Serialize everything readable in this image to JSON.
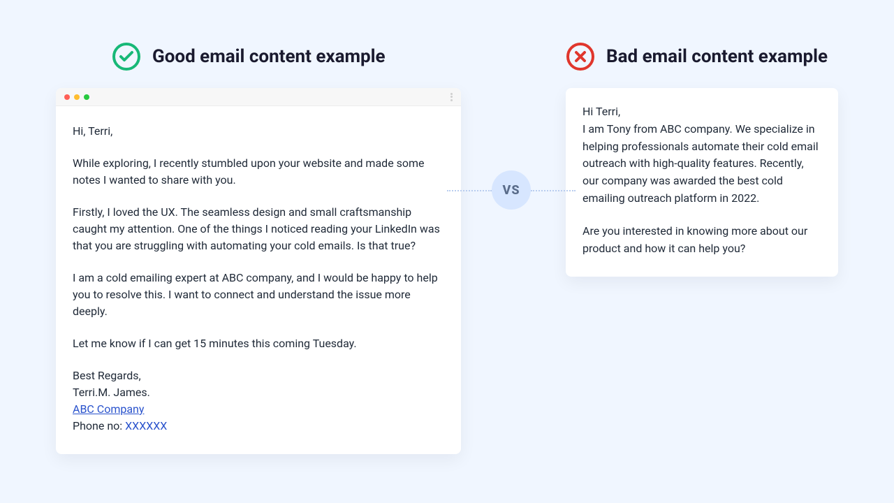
{
  "good": {
    "title": "Good email content example",
    "icon": "check-circle-icon",
    "greeting": "Hi, Terri,",
    "para1": "While exploring, I recently stumbled upon your website and made some notes I wanted to share with you.",
    "para2": "Firstly, I loved the UX. The seamless design and small craftsmanship caught my attention. One of the things I noticed reading your LinkedIn was that you are struggling with automating your cold emails. Is that true?",
    "para3": "I am a cold emailing expert at ABC company, and I would be happy to help you to resolve this. I want to connect and understand the issue more deeply.",
    "para4": "Let me know if I can get 15 minutes this coming Tuesday.",
    "signoff": "Best Regards,",
    "signature_name": "Terri.M. James.",
    "company_link": "ABC Company",
    "phone_label": "Phone no: ",
    "phone_value": "XXXXXX"
  },
  "bad": {
    "title": "Bad email content example",
    "icon": "x-circle-icon",
    "greeting": "Hi Terri,",
    "para1": "I am Tony from ABC company. We specialize in helping professionals automate their cold email outreach with high-quality features. Recently, our company was awarded the best cold emailing outreach platform in 2022.",
    "para2": "Are you interested in knowing more about our product and how it can help you?"
  },
  "vs_label": "VS",
  "colors": {
    "good": "#17b877",
    "bad": "#e0362c",
    "link": "#2952cc"
  }
}
